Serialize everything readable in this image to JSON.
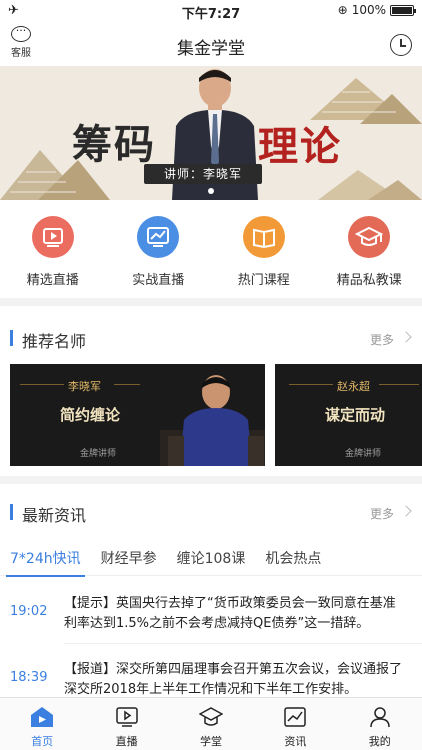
{
  "status_bar": {
    "time": "下午7:27",
    "battery": "100%"
  },
  "header": {
    "title": "集金学堂",
    "service_label": "客服"
  },
  "banner": {
    "title_left": "筹码",
    "title_right": "理论",
    "lecturer_tag": "讲师：李晓军"
  },
  "quick_nav": [
    {
      "label": "精选直播",
      "color": "#ea6d5f"
    },
    {
      "label": "实战直播",
      "color": "#4a8fe3"
    },
    {
      "label": "热门课程",
      "color": "#f29a38"
    },
    {
      "label": "精品私教课",
      "color": "#e46a58"
    }
  ],
  "teachers_section": {
    "title": "推荐名师",
    "more": "更多",
    "cards": [
      {
        "name": "李晓军",
        "slogan": "简约缠论",
        "grade": "金牌讲师"
      },
      {
        "name": "赵永超",
        "slogan": "谋定而动",
        "grade": "金牌讲师"
      }
    ]
  },
  "news_section": {
    "title": "最新资讯",
    "more": "更多",
    "tabs": [
      "7*24h快讯",
      "财经早参",
      "缠论108课",
      "机会热点"
    ],
    "items": [
      {
        "time": "19:02",
        "text": "【提示】英国央行去掉了“货币政策委员会一致同意在基准利率达到1.5%之前不会考虑减持QE债券”这一措辞。"
      },
      {
        "time": "18:39",
        "text": "【报道】深交所第四届理事会召开第五次会议，会议通报了深交所2018年上半年工作情况和下半年工作安排。"
      }
    ]
  },
  "tab_bar": [
    {
      "label": "首页",
      "active": true
    },
    {
      "label": "直播",
      "active": false
    },
    {
      "label": "学堂",
      "active": false
    },
    {
      "label": "资讯",
      "active": false
    },
    {
      "label": "我的",
      "active": false
    }
  ],
  "colors": {
    "accent": "#3b7fe0",
    "banner_bg": "#efe9df",
    "card_bg": "#1a1a1a"
  }
}
